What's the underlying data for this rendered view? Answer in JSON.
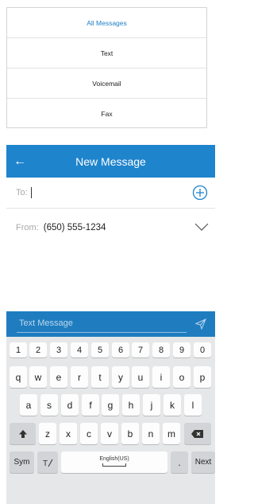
{
  "menu": {
    "items": [
      {
        "label": "All Messages",
        "active": true
      },
      {
        "label": "Text",
        "active": false
      },
      {
        "label": "Voicemail",
        "active": false
      },
      {
        "label": "Fax",
        "active": false
      }
    ]
  },
  "compose": {
    "title": "New Message",
    "to_label": "To:",
    "from_label": "From:",
    "from_number": "(650) 555-1234",
    "message_placeholder": "Text Message"
  },
  "keyboard": {
    "row1": [
      "1",
      "2",
      "3",
      "4",
      "5",
      "6",
      "7",
      "8",
      "9",
      "0"
    ],
    "row2": [
      "q",
      "w",
      "e",
      "r",
      "t",
      "y",
      "u",
      "i",
      "o",
      "p"
    ],
    "row3": [
      "a",
      "s",
      "d",
      "f",
      "g",
      "h",
      "j",
      "k",
      "l"
    ],
    "row4": [
      "z",
      "x",
      "c",
      "v",
      "b",
      "n",
      "m"
    ],
    "sym_label": "Sym",
    "space_label": "English(US)",
    "period_label": ".",
    "next_label": "Next"
  },
  "colors": {
    "accent": "#1e84cc",
    "menu_active": "#1d7fc4",
    "keyboard_bg": "#e6e7e9"
  },
  "icons": {
    "back": "arrow-left",
    "add_recipient": "plus-circle",
    "from_dropdown": "chevron-down",
    "send": "paper-plane",
    "shift": "arrow-up",
    "backspace": "backspace",
    "handwriting": "pen-t"
  }
}
